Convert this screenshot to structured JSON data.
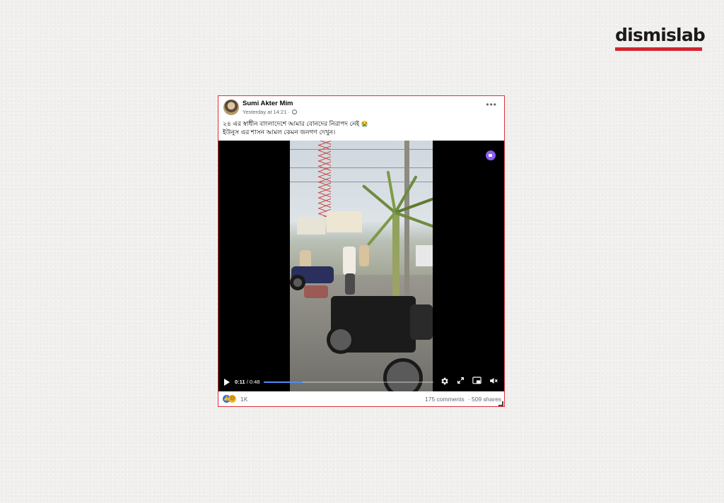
{
  "brand": {
    "name": "dismislab",
    "bar_color": "#d3252f"
  },
  "post": {
    "author": "Sumi Akter Mim",
    "timestamp": "Yesterday at 14:21",
    "separator": "·",
    "visibility_icon": "globe-icon",
    "more_icon": "more-options-icon",
    "more_glyph": "•••",
    "caption_line1": "২৪ এর স্বাধীন বাংলাদেশে আমার বোনদের নিরাপদ নেই",
    "caption_emoji": "😭",
    "caption_line2": "ইউনুস এর শাসন আমল কেমন জনগণ দেখুন।"
  },
  "video": {
    "current_time": "0:11",
    "total_time": " / 0:48",
    "progress": 0.23,
    "progress_color": "#4f8cf7",
    "badge_color": "#8b5cf6",
    "icons": [
      "play-icon",
      "settings-icon",
      "fullscreen-icon",
      "picture-in-picture-icon",
      "volume-icon"
    ]
  },
  "footer": {
    "reactions": [
      "like-icon",
      "sad-icon"
    ],
    "reaction_count": "1K",
    "comments": "175 comments",
    "dot": "·",
    "shares": "509 shares"
  }
}
